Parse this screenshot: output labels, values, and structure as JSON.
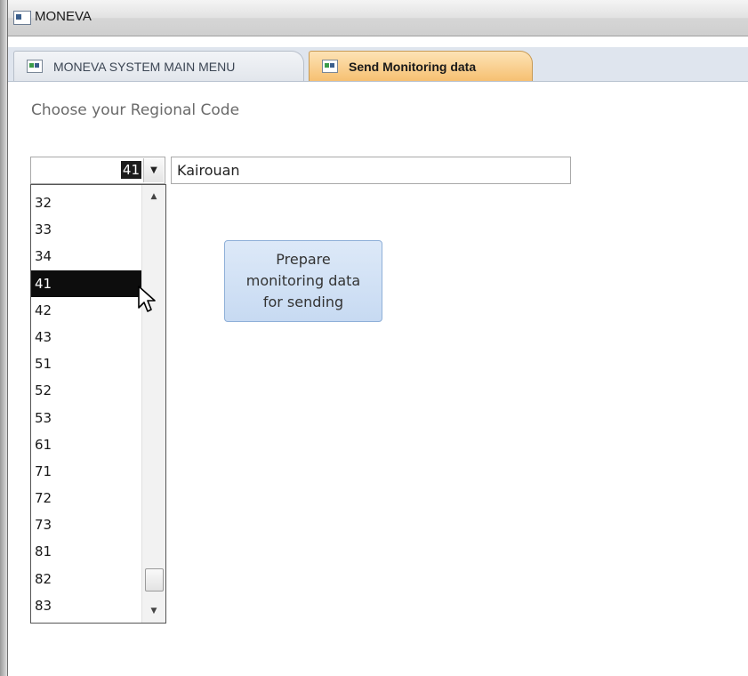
{
  "window": {
    "title": "MONEVA"
  },
  "tabs": [
    {
      "label": "MONEVA SYSTEM MAIN MENU",
      "active": false
    },
    {
      "label": "Send Monitoring data",
      "active": true
    }
  ],
  "form": {
    "prompt": "Choose your Regional Code",
    "regional_code": {
      "selected_value": "41",
      "options": [
        "32",
        "33",
        "34",
        "41",
        "42",
        "43",
        "51",
        "52",
        "53",
        "61",
        "71",
        "72",
        "73",
        "81",
        "82",
        "83"
      ]
    },
    "region_name": "Kairouan",
    "action_button": {
      "line1": "Prepare",
      "line2": "monitoring data",
      "line3": "for sending"
    }
  },
  "colors": {
    "active_tab": "#f6c072",
    "button_fill": "#c7daf2",
    "selection": "#0d0d0d"
  },
  "icons": {
    "app": "form-icon",
    "dropdown": "chevron-down-icon",
    "scroll_up": "scroll-up-arrow-icon",
    "scroll_down": "scroll-down-arrow-icon",
    "cursor": "mouse-pointer-icon"
  }
}
